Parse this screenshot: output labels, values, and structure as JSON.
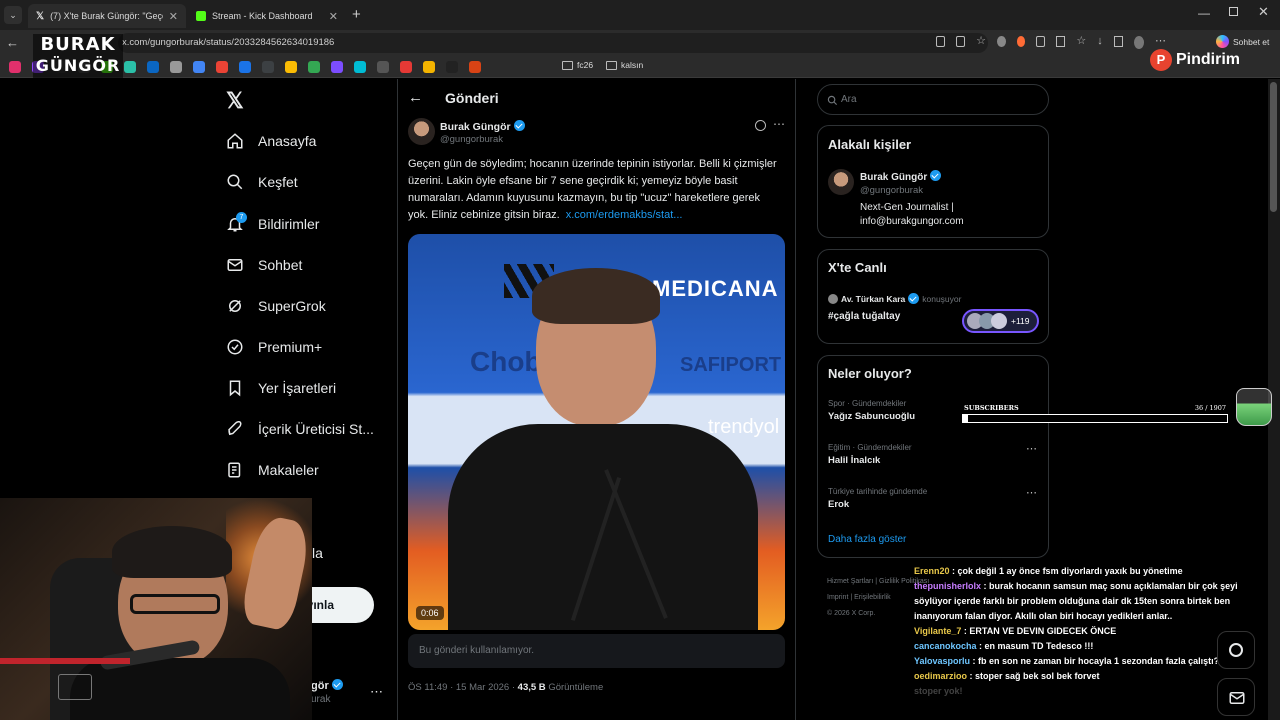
{
  "browser": {
    "tabs": [
      {
        "label": "(7) X'te Burak Güngör: \"Geçen gün"
      },
      {
        "label": "Stream - Kick Dashboard"
      }
    ],
    "url": "x.com/gungorburak/status/2033284562634019186",
    "copilot_label": "Sohbet et",
    "bookmarks": [
      "fc26",
      "kalsın"
    ]
  },
  "overlay": {
    "logo_line1": "BURAK",
    "logo_line2": "GÜNGÖR",
    "sponsor": "Pindirim",
    "subscribers_label": "SUBSCRIBERS",
    "subscribers_value": "36 / 1907",
    "subscribers_progress": 0.019
  },
  "sidebar": {
    "items": [
      {
        "label": "Anasayfa",
        "icon": "home-icon"
      },
      {
        "label": "Keşfet",
        "icon": "search-icon"
      },
      {
        "label": "Bildirimler",
        "icon": "bell-icon",
        "badge": "7"
      },
      {
        "label": "Sohbet",
        "icon": "mail-icon"
      },
      {
        "label": "SuperGrok",
        "icon": "grok-icon"
      },
      {
        "label": "Premium+",
        "icon": "premium-icon"
      },
      {
        "label": "Yer İşaretleri",
        "icon": "bookmark-icon"
      },
      {
        "label": "İçerik Üreticisi St...",
        "icon": "rocket-icon"
      },
      {
        "label": "Makaleler",
        "icon": "article-icon"
      }
    ],
    "partial_item": "la",
    "post_button_partial": "ayınla",
    "profile_name_partial": "gör",
    "profile_handle_partial": "urak"
  },
  "post": {
    "header_title": "Gönderi",
    "author_name": "Burak Güngör",
    "author_handle": "@gungorburak",
    "text": "Geçen gün de söyledim; hocanın üzerinde tepinin istiyorlar. Belli ki çizmişler üzerini. Lakin öyle efsane bir 7 sene geçirdik ki; yemeyiz böyle basit numaraları. Adamın kuyusunu kazmayın, bu tip \"ucuz\" hareketlere gerek yok. Eliniz cebinize gitsin biraz.",
    "link": "x.com/erdemakbs/stat...",
    "video_time": "0:06",
    "video_sponsors": [
      "MEDICANA",
      "Chob",
      "SAFIPORT",
      "trendyol"
    ],
    "reply_disabled": "Bu gönderi kullanılamıyor.",
    "time": "ÖS 11:49 · 15 Mar 2026 · ",
    "views_count": "43,5 B",
    "views_label": " Görüntüleme"
  },
  "right": {
    "search_placeholder": "Ara",
    "related_title": "Alakalı kişiler",
    "related_name": "Burak Güngör",
    "related_handle": "@gungorburak",
    "related_bio_1": "Next-Gen Journalist |",
    "related_bio_2": "info@burakgungor.com",
    "live_title": "X'te Canlı",
    "live_host": "Av. Türkan Kara",
    "live_status": "konuşuyor",
    "live_topic": "#çağla tuğaltay",
    "live_count": "+119",
    "trends_title": "Neler oluyor?",
    "trends": [
      {
        "meta": "Spor · Gündemdekiler",
        "name": "Yağız Sabuncuoğlu"
      },
      {
        "meta": "Eğitim · Gündemdekiler",
        "name": "Halil İnalcık"
      },
      {
        "meta": "Türkiye tarihinde gündemde",
        "name": "Erok"
      }
    ],
    "show_more": "Daha fazla göster",
    "footer_1": "Hizmet Şartları",
    "footer_2": "Gizlilik Politikası",
    "footer_3": "Imprint",
    "footer_4": "Erişilebilirlik",
    "footer_5": "© 2026 X Corp."
  },
  "chat": [
    {
      "user": "Erenn20",
      "color": "#e8c84a",
      "msg": " : çok değil 1 ay önce fsm diyorlardı yaxık bu yönetime"
    },
    {
      "user": "thepunisherlolx",
      "color": "#c77dff",
      "msg": " : burak hocanın samsun maç sonu açıklamaları bir çok şeyi söylüyor içerde farklı bir problem olduğuna dair dk 15ten sonra birtek ben inanıyorum falan diyor. Akıllı olan biri hocayı yedikleri anlar.."
    },
    {
      "user": "Vigilante_7",
      "color": "#e8c84a",
      "msg": " : ERTAN VE DEVIN GIDECEK ÖNCE"
    },
    {
      "user": "cancanokocha",
      "color": "#6ec6ff",
      "msg": " : en masum TD Tedesco !!!"
    },
    {
      "user": "Yalovasporlu",
      "color": "#6ec6ff",
      "msg": " : fb en son ne zaman bir hocayla 1 sezondan fazla çalıştı?"
    },
    {
      "user": "oedimarzioo",
      "color": "#e8c84a",
      "msg": " : stoper sağ bek sol bek forvet"
    },
    {
      "user": "",
      "color": "#888888",
      "msg": "stoper yok!"
    }
  ]
}
